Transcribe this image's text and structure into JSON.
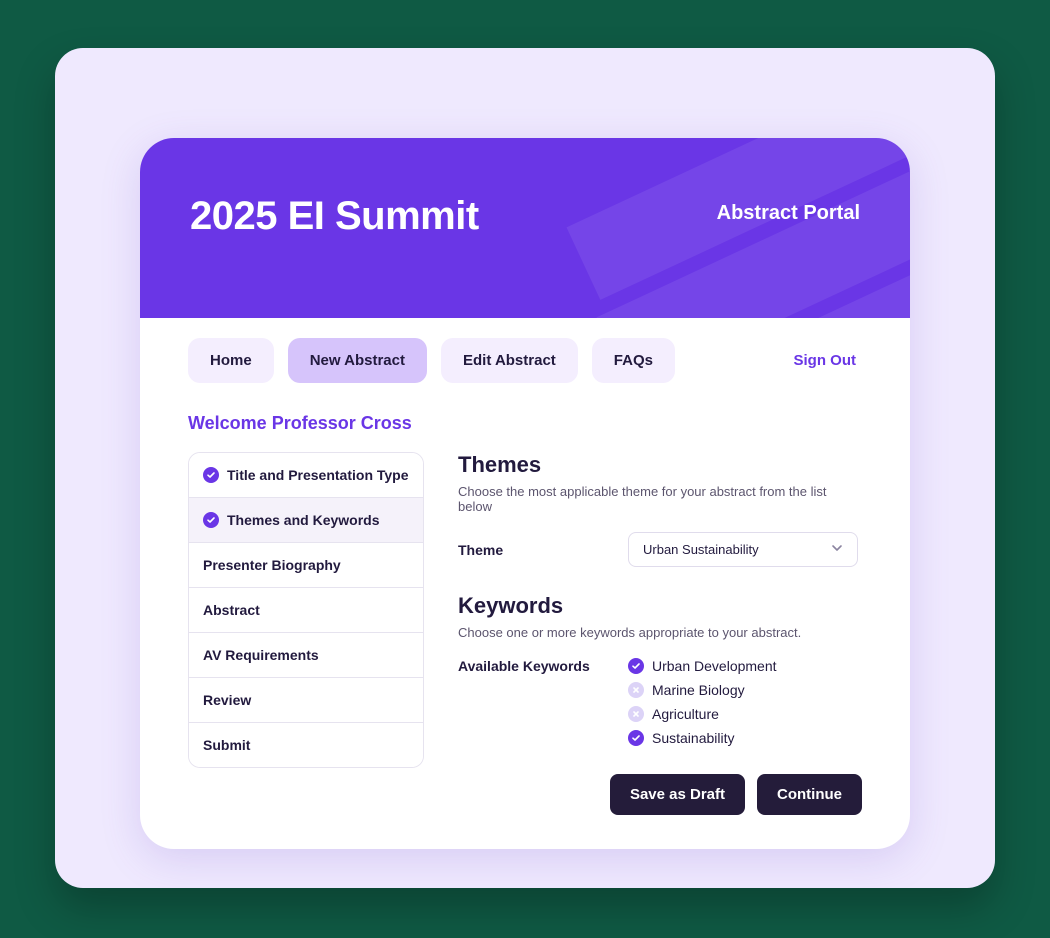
{
  "banner": {
    "title": "2025 EI Summit",
    "subtitle": "Abstract Portal"
  },
  "nav": {
    "items": [
      {
        "label": "Home",
        "active": false
      },
      {
        "label": "New Abstract",
        "active": true
      },
      {
        "label": "Edit Abstract",
        "active": false
      },
      {
        "label": "FAQs",
        "active": false
      }
    ],
    "signout": "Sign Out"
  },
  "welcome": "Welcome Professor Cross",
  "steps": [
    {
      "label": "Title and Presentation Type",
      "done": true,
      "active": false
    },
    {
      "label": "Themes and Keywords",
      "done": true,
      "active": true
    },
    {
      "label": "Presenter Biography",
      "done": false,
      "active": false
    },
    {
      "label": "Abstract",
      "done": false,
      "active": false
    },
    {
      "label": "AV Requirements",
      "done": false,
      "active": false
    },
    {
      "label": "Review",
      "done": false,
      "active": false
    },
    {
      "label": "Submit",
      "done": false,
      "active": false
    }
  ],
  "themes": {
    "heading": "Themes",
    "hint": "Choose the most applicable theme for your abstract from the list below",
    "field_label": "Theme",
    "selected": "Urban Sustainability"
  },
  "keywords": {
    "heading": "Keywords",
    "hint": "Choose one or more keywords appropriate to your abstract.",
    "field_label": "Available Keywords",
    "items": [
      {
        "label": "Urban Development",
        "selected": true
      },
      {
        "label": "Marine Biology",
        "selected": false
      },
      {
        "label": "Agriculture",
        "selected": false
      },
      {
        "label": "Sustainability",
        "selected": true
      }
    ]
  },
  "actions": {
    "save": "Save as Draft",
    "continue": "Continue"
  }
}
